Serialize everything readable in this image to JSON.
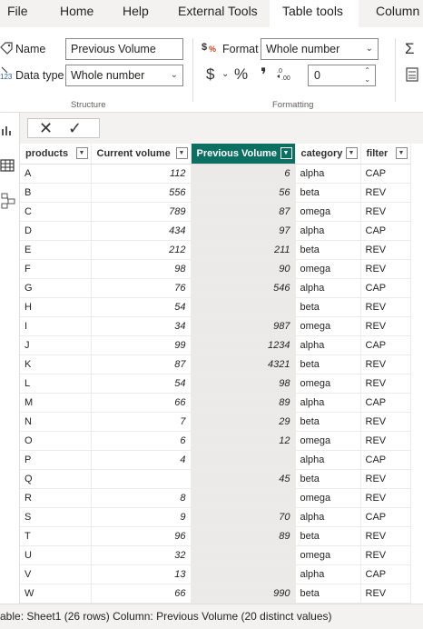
{
  "ribbon_tabs": [
    "File",
    "Home",
    "Help",
    "External Tools",
    "Table tools",
    "Column"
  ],
  "active_tab": "Table tools",
  "structure": {
    "name_label": "Name",
    "name_value": "Previous Volume",
    "datatype_label": "Data type",
    "datatype_value": "Whole number",
    "group_label": "Structure"
  },
  "formatting": {
    "format_label": "Format",
    "format_value": "Whole number",
    "currency_symbol": "$",
    "percent_symbol": "%",
    "comma_symbol": "'",
    "decimals_value": "0",
    "group_label": "Formatting"
  },
  "columns": [
    "products",
    "Current volume",
    "Previous Volume",
    "category",
    "filter"
  ],
  "selected_column": "Previous Volume",
  "rows": [
    [
      "A",
      "112",
      "6",
      "alpha",
      "CAP"
    ],
    [
      "B",
      "556",
      "56",
      "beta",
      "REV"
    ],
    [
      "C",
      "789",
      "87",
      "omega",
      "REV"
    ],
    [
      "D",
      "434",
      "97",
      "alpha",
      "CAP"
    ],
    [
      "E",
      "212",
      "211",
      "beta",
      "REV"
    ],
    [
      "F",
      "98",
      "90",
      "omega",
      "REV"
    ],
    [
      "G",
      "76",
      "546",
      "alpha",
      "CAP"
    ],
    [
      "H",
      "54",
      "",
      "beta",
      "REV"
    ],
    [
      "I",
      "34",
      "987",
      "omega",
      "REV"
    ],
    [
      "J",
      "99",
      "1234",
      "alpha",
      "CAP"
    ],
    [
      "K",
      "87",
      "4321",
      "beta",
      "REV"
    ],
    [
      "L",
      "54",
      "98",
      "omega",
      "REV"
    ],
    [
      "M",
      "66",
      "89",
      "alpha",
      "CAP"
    ],
    [
      "N",
      "7",
      "29",
      "beta",
      "REV"
    ],
    [
      "O",
      "6",
      "12",
      "omega",
      "REV"
    ],
    [
      "P",
      "4",
      "",
      "alpha",
      "CAP"
    ],
    [
      "Q",
      "",
      "45",
      "beta",
      "REV"
    ],
    [
      "R",
      "8",
      "",
      "omega",
      "REV"
    ],
    [
      "S",
      "9",
      "70",
      "alpha",
      "CAP"
    ],
    [
      "T",
      "96",
      "89",
      "beta",
      "REV"
    ],
    [
      "U",
      "32",
      "",
      "omega",
      "REV"
    ],
    [
      "V",
      "13",
      "",
      "alpha",
      "CAP"
    ],
    [
      "W",
      "66",
      "990",
      "beta",
      "REV"
    ]
  ],
  "status_text": "able: Sheet1 (26 rows) Column: Previous Volume (20 distinct values)",
  "colors": {
    "selected_header": "#0b7062",
    "selected_column_bg": "#ebeae8",
    "ribbon_bg": "#ffffff",
    "chrome_bg": "#f3f2f1"
  },
  "icons": [
    "name-tag-icon",
    "data-type-icon",
    "format-icon",
    "currency-icon",
    "percent-icon",
    "comma-icon",
    "decimal-places-icon",
    "sum-icon",
    "calculator-icon",
    "report-view-icon",
    "table-view-icon",
    "model-view-icon",
    "cancel-icon",
    "commit-icon",
    "filter-dropdown-icon"
  ]
}
